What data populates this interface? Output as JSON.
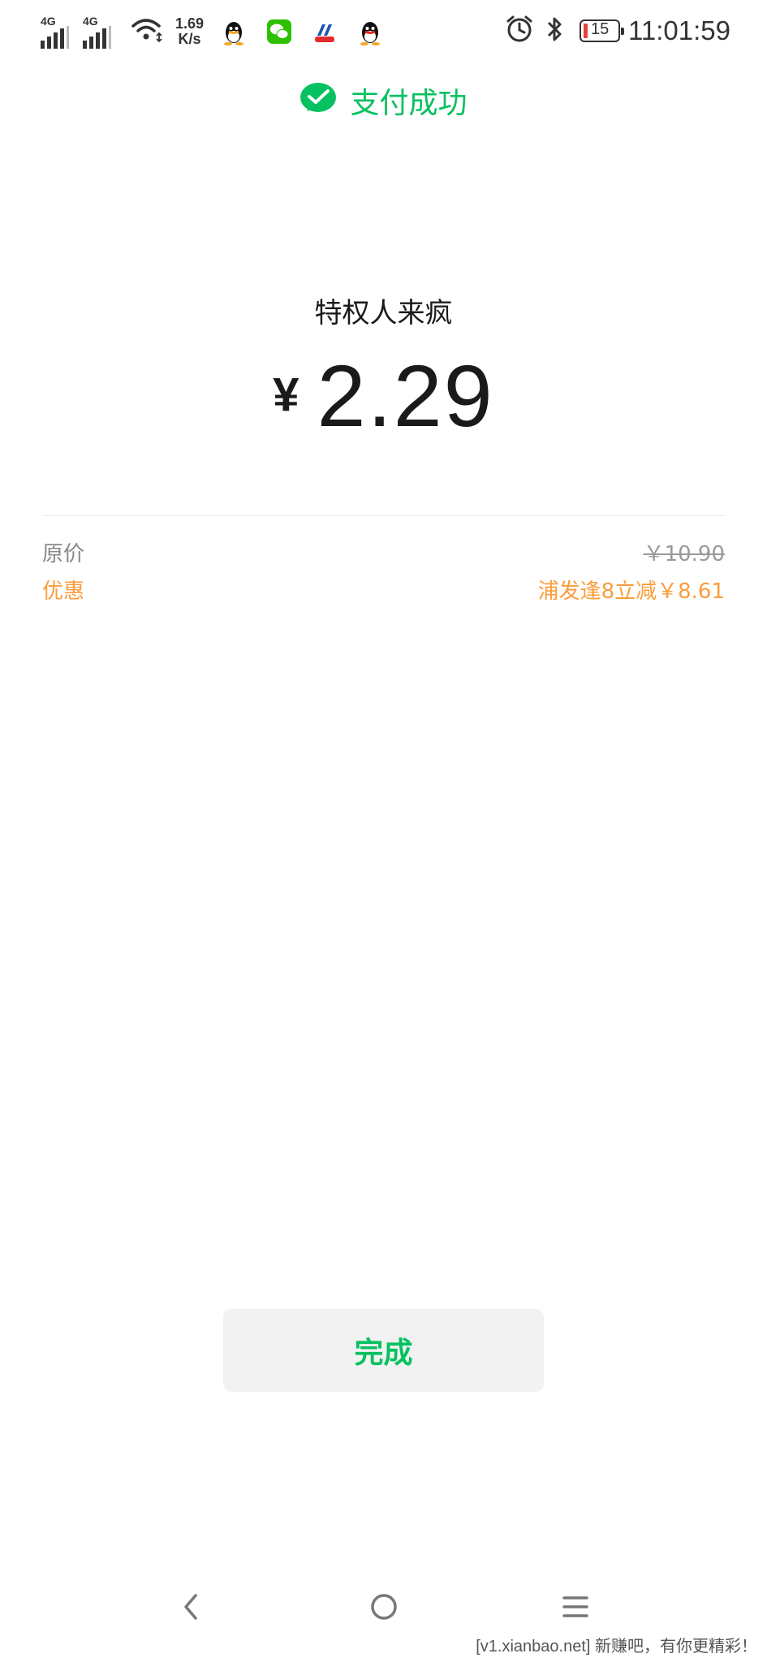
{
  "status_bar": {
    "signal_1_label": "4G",
    "signal_2_label": "4G",
    "net_speed_value": "1.69",
    "net_speed_unit": "K/s",
    "battery_level": "15",
    "time": "11:01:59",
    "icons": [
      "signal-icon",
      "signal-icon",
      "wifi-icon",
      "qq-icon",
      "wechat-icon",
      "bank-app-icon",
      "qq-icon",
      "alarm-icon",
      "bluetooth-icon",
      "battery-icon"
    ],
    "battery_color": "#e5413a"
  },
  "header": {
    "title": "支付成功",
    "icon": "wechat-pay-icon",
    "accent_color": "#07c160"
  },
  "payment": {
    "merchant": "特权人来疯",
    "currency": "¥",
    "amount": "2.29"
  },
  "details": {
    "original_label": "原价",
    "original_value": "￥10.90",
    "discount_label": "优惠",
    "discount_value": "浦发逢8立减￥8.61",
    "discount_color": "#fa9d3b"
  },
  "actions": {
    "done_label": "完成"
  },
  "nav_bar": {
    "icons": [
      "back-icon",
      "home-icon",
      "menu-icon"
    ]
  },
  "watermark": {
    "text": "[v1.xianbao.net] 新赚吧，有你更精彩！"
  }
}
